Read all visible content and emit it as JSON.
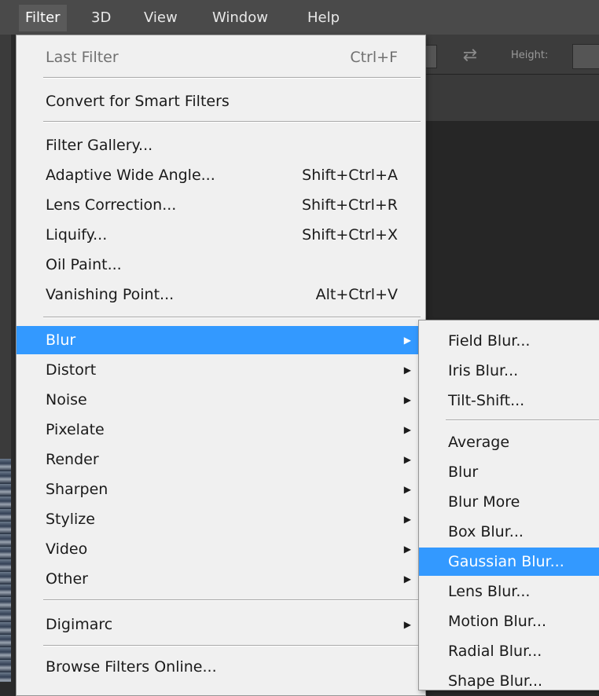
{
  "menubar": {
    "items": [
      {
        "label": "Filter"
      },
      {
        "label": "3D"
      },
      {
        "label": "View"
      },
      {
        "label": "Window"
      },
      {
        "label": "Help"
      }
    ]
  },
  "options_bar": {
    "height_label": "Height:",
    "swap_icon": "swap-arrows-icon"
  },
  "filter_menu": {
    "last_filter": {
      "label": "Last Filter",
      "shortcut": "Ctrl+F"
    },
    "convert_smart": {
      "label": "Convert for Smart Filters"
    },
    "filter_gallery": {
      "label": "Filter Gallery..."
    },
    "adaptive_wide_angle": {
      "label": "Adaptive Wide Angle...",
      "shortcut": "Shift+Ctrl+A"
    },
    "lens_correction": {
      "label": "Lens Correction...",
      "shortcut": "Shift+Ctrl+R"
    },
    "liquify": {
      "label": "Liquify...",
      "shortcut": "Shift+Ctrl+X"
    },
    "oil_paint": {
      "label": "Oil Paint..."
    },
    "vanishing_point": {
      "label": "Vanishing Point...",
      "shortcut": "Alt+Ctrl+V"
    },
    "blur": {
      "label": "Blur"
    },
    "distort": {
      "label": "Distort"
    },
    "noise": {
      "label": "Noise"
    },
    "pixelate": {
      "label": "Pixelate"
    },
    "render": {
      "label": "Render"
    },
    "sharpen": {
      "label": "Sharpen"
    },
    "stylize": {
      "label": "Stylize"
    },
    "video": {
      "label": "Video"
    },
    "other": {
      "label": "Other"
    },
    "digimarc": {
      "label": "Digimarc"
    },
    "browse_online": {
      "label": "Browse Filters Online..."
    },
    "submenu_arrow": "▶"
  },
  "blur_submenu": {
    "field_blur": "Field Blur...",
    "iris_blur": "Iris Blur...",
    "tilt_shift": "Tilt-Shift...",
    "average": "Average",
    "blur": "Blur",
    "blur_more": "Blur More",
    "box_blur": "Box Blur...",
    "gaussian_blur": "Gaussian Blur...",
    "lens_blur": "Lens Blur...",
    "motion_blur": "Motion Blur...",
    "radial_blur": "Radial Blur...",
    "shape_blur": "Shape Blur..."
  },
  "colors": {
    "highlight": "#3399ff",
    "menu_bg": "#f0f0f0",
    "menubar_bg": "#4a4a4a"
  }
}
